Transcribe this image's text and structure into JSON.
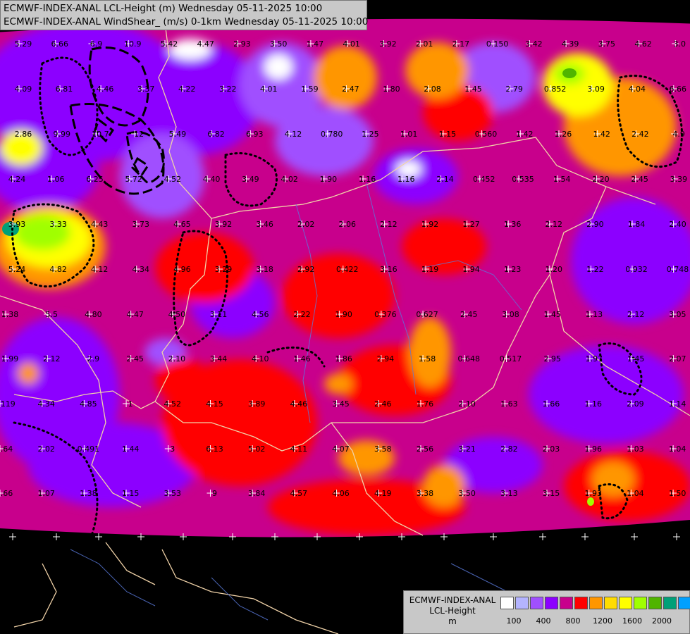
{
  "header": {
    "line1": "ECMWF-INDEX-ANAL LCL-Height (m) Wednesday 05-11-2025 10:00",
    "line2": "ECMWF-INDEX-ANAL WindShear_ (m/s) 0-1km Wednesday 05-11-2025 10:00"
  },
  "legend": {
    "title_line1": "ECMWF-INDEX-ANAL",
    "title_line2": "LCL-Height",
    "title_line3": "m",
    "colors": [
      "#ffffff",
      "#b4b4ff",
      "#a050ff",
      "#8c00ff",
      "#c8008c",
      "#ff0000",
      "#ff9600",
      "#ffdc00",
      "#ffff00",
      "#a0ff00",
      "#50b400",
      "#00a078",
      "#00a0ff"
    ],
    "tick_labels": [
      "100",
      "400",
      "800",
      "1200",
      "1600",
      "2000"
    ]
  },
  "map": {
    "background": "#000000",
    "wind_shear_values": [
      "5.29",
      "6.66",
      "6.9",
      "10.9",
      "5.42",
      "4.47",
      "2.93",
      "3.50",
      "1.47",
      "4.01",
      "3.92",
      "2.01",
      "2.17",
      "0.150",
      "3.42",
      "4.39",
      "3.75",
      "4.62",
      "3.0",
      "4.09",
      "6.81",
      "4.46",
      "3.37",
      "4.22",
      "3.22",
      "4.01",
      "1.59",
      "2.47",
      "1.80",
      "2.08",
      "1.45",
      "2.79",
      "0.852",
      "3.09",
      "4.04",
      "6.66",
      "2.86",
      "9.99",
      "10.7",
      "12",
      "5.49",
      "6.82",
      "6.93",
      "4.12",
      "0.780",
      "1.25",
      "1.01",
      "1.15",
      "0.560",
      "1.42",
      "1.26",
      "1.42",
      "2.42",
      "4.9",
      "4.24",
      "1.06",
      "6.25",
      "5.72",
      "4.52",
      "4.40",
      "3.49",
      "4.02",
      "1.90",
      "1.16",
      "1.16",
      "2.14",
      "0.452",
      "0.535",
      "1.54",
      "2.20",
      "2.45",
      "3.39",
      "3.93",
      "3.33",
      "4.43",
      "3.73",
      "4.65",
      "3.92",
      "3.46",
      "2.02",
      "2.06",
      "2.12",
      "1.92",
      "1.27",
      "1.36",
      "2.12",
      "2.90",
      "1.84",
      "2.40",
      "5.24",
      "4.82",
      "4.12",
      "4.34",
      "4.96",
      "3.29",
      "3.18",
      "2.92",
      "0.422",
      "3.16",
      "1.19",
      "1.94",
      "1.23",
      "1.20",
      "1.22",
      "0.932",
      "0.748",
      "1.38",
      "5.5",
      "4.80",
      "4.47",
      "4.50",
      "3.11",
      "4.56",
      "2.22",
      "1.90",
      "0.376",
      "0.627",
      "2.45",
      "3.08",
      "1.45",
      "1.13",
      "2.12",
      "3.05",
      "1.99",
      "2.12",
      "2.9",
      "2.45",
      "2.10",
      "3.44",
      "4.10",
      "1.46",
      "1.86",
      "2.94",
      "1.58",
      "0.648",
      "0.517",
      "2.95",
      "1.97",
      "1.45",
      "2.07",
      "0.119",
      "4.34",
      "4.85",
      "1",
      "4.52",
      "4.15",
      "3.89",
      "4.46",
      "3.45",
      "2.46",
      "1.76",
      "2.10",
      "1.63",
      "1.66",
      "1.16",
      "2.09",
      "1.14",
      "1.64",
      "2.02",
      "0.491",
      "1.44",
      "3",
      "6.13",
      "5.02",
      "4.11",
      "4.07",
      "3.58",
      "2.56",
      "3.21",
      "2.82",
      "2.03",
      "1.96",
      "1.03",
      "1.04",
      "1.66",
      "1.07",
      "1.38",
      "1.15",
      "3.53",
      "9",
      "3.84",
      "4.57",
      "4.06",
      "4.19",
      "3.38",
      "3.50",
      "3.13",
      "3.15",
      "1.93",
      "1.04",
      "1.50",
      "1.96",
      "1.71",
      "1.63",
      "2.05",
      "1.54",
      "1.08"
    ]
  }
}
